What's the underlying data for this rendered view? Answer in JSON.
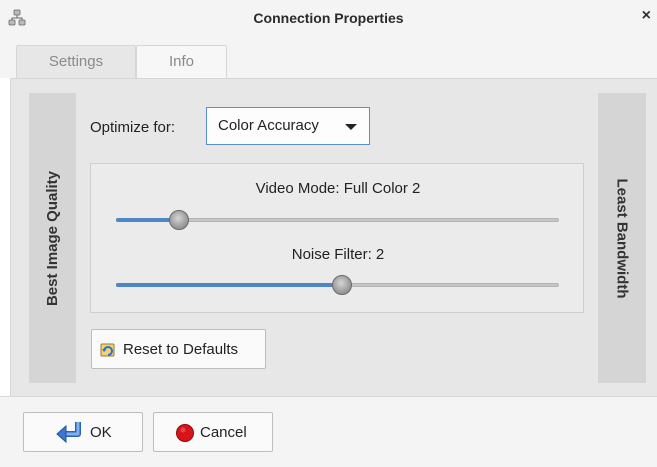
{
  "window": {
    "title": "Connection Properties",
    "close_glyph": "×",
    "app_icon": "network-icon"
  },
  "tabs": [
    {
      "label": "Settings",
      "active": true
    },
    {
      "label": "Info",
      "active": false
    }
  ],
  "settings": {
    "left_label": "Best Image Quality",
    "right_label": "Least Bandwidth",
    "optimize_label": "Optimize for:",
    "optimize_value": "Color Accuracy",
    "video_mode": {
      "label": "Video Mode: Full Color 2",
      "fraction": 0.14
    },
    "noise_filter": {
      "label": "Noise Filter: 2",
      "fraction": 0.51
    },
    "reset_label": "Reset to Defaults",
    "reset_icon": "reset-icon"
  },
  "footer": {
    "ok_label": "OK",
    "ok_icon": "ok-return-arrow-icon",
    "cancel_label": "Cancel",
    "cancel_icon": "red-circle-icon"
  },
  "colors": {
    "accent": "#4f86c6",
    "cancel_red": "#d8141a"
  }
}
